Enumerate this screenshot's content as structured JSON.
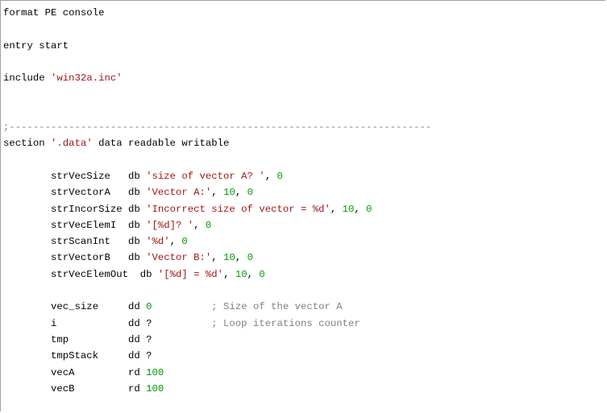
{
  "editor": {
    "lines": [
      [
        {
          "t": "format PE console",
          "c": "kw"
        }
      ],
      [],
      [
        {
          "t": "entry start",
          "c": "kw"
        }
      ],
      [],
      [
        {
          "t": "include ",
          "c": "kw"
        },
        {
          "t": "'win32a.inc'",
          "c": "str"
        }
      ],
      [],
      [],
      [
        {
          "t": ";-----------------------------------------------------------------------",
          "c": "comment"
        }
      ],
      [
        {
          "t": "section ",
          "c": "kw"
        },
        {
          "t": "'.data'",
          "c": "str"
        },
        {
          "t": " data readable writable",
          "c": "kw"
        }
      ],
      [],
      [
        {
          "t": "        strVecSize   db ",
          "c": "kw"
        },
        {
          "t": "'size of vector A? '",
          "c": "str"
        },
        {
          "t": ", ",
          "c": "kw"
        },
        {
          "t": "0",
          "c": "num"
        }
      ],
      [
        {
          "t": "        strVectorA   db ",
          "c": "kw"
        },
        {
          "t": "'Vector A:'",
          "c": "str"
        },
        {
          "t": ", ",
          "c": "kw"
        },
        {
          "t": "10",
          "c": "num"
        },
        {
          "t": ", ",
          "c": "kw"
        },
        {
          "t": "0",
          "c": "num"
        }
      ],
      [
        {
          "t": "        strIncorSize db ",
          "c": "kw"
        },
        {
          "t": "'Incorrect size of vector = %d'",
          "c": "str"
        },
        {
          "t": ", ",
          "c": "kw"
        },
        {
          "t": "10",
          "c": "num"
        },
        {
          "t": ", ",
          "c": "kw"
        },
        {
          "t": "0",
          "c": "num"
        }
      ],
      [
        {
          "t": "        strVecElemI  db ",
          "c": "kw"
        },
        {
          "t": "'[%d]? '",
          "c": "str"
        },
        {
          "t": ", ",
          "c": "kw"
        },
        {
          "t": "0",
          "c": "num"
        }
      ],
      [
        {
          "t": "        strScanInt   db ",
          "c": "kw"
        },
        {
          "t": "'%d'",
          "c": "str"
        },
        {
          "t": ", ",
          "c": "kw"
        },
        {
          "t": "0",
          "c": "num"
        }
      ],
      [
        {
          "t": "        strVectorB   db ",
          "c": "kw"
        },
        {
          "t": "'Vector B:'",
          "c": "str"
        },
        {
          "t": ", ",
          "c": "kw"
        },
        {
          "t": "10",
          "c": "num"
        },
        {
          "t": ", ",
          "c": "kw"
        },
        {
          "t": "0",
          "c": "num"
        }
      ],
      [
        {
          "t": "        strVecElemOut  db ",
          "c": "kw"
        },
        {
          "t": "'[%d] = %d'",
          "c": "str"
        },
        {
          "t": ", ",
          "c": "kw"
        },
        {
          "t": "10",
          "c": "num"
        },
        {
          "t": ", ",
          "c": "kw"
        },
        {
          "t": "0",
          "c": "num"
        }
      ],
      [],
      [
        {
          "t": "        vec_size     dd ",
          "c": "kw"
        },
        {
          "t": "0",
          "c": "num"
        },
        {
          "t": "          ",
          "c": "kw"
        },
        {
          "t": "; Size of the vector A",
          "c": "comment"
        }
      ],
      [
        {
          "t": "        i            dd ?          ",
          "c": "kw"
        },
        {
          "t": "; Loop iterations counter",
          "c": "comment"
        }
      ],
      [
        {
          "t": "        tmp          dd ?",
          "c": "kw"
        }
      ],
      [
        {
          "t": "        tmpStack     dd ?",
          "c": "kw"
        }
      ],
      [
        {
          "t": "        vecA         rd ",
          "c": "kw"
        },
        {
          "t": "100",
          "c": "num"
        }
      ],
      [
        {
          "t": "        vecB         rd ",
          "c": "kw"
        },
        {
          "t": "100",
          "c": "num"
        }
      ],
      []
    ]
  }
}
